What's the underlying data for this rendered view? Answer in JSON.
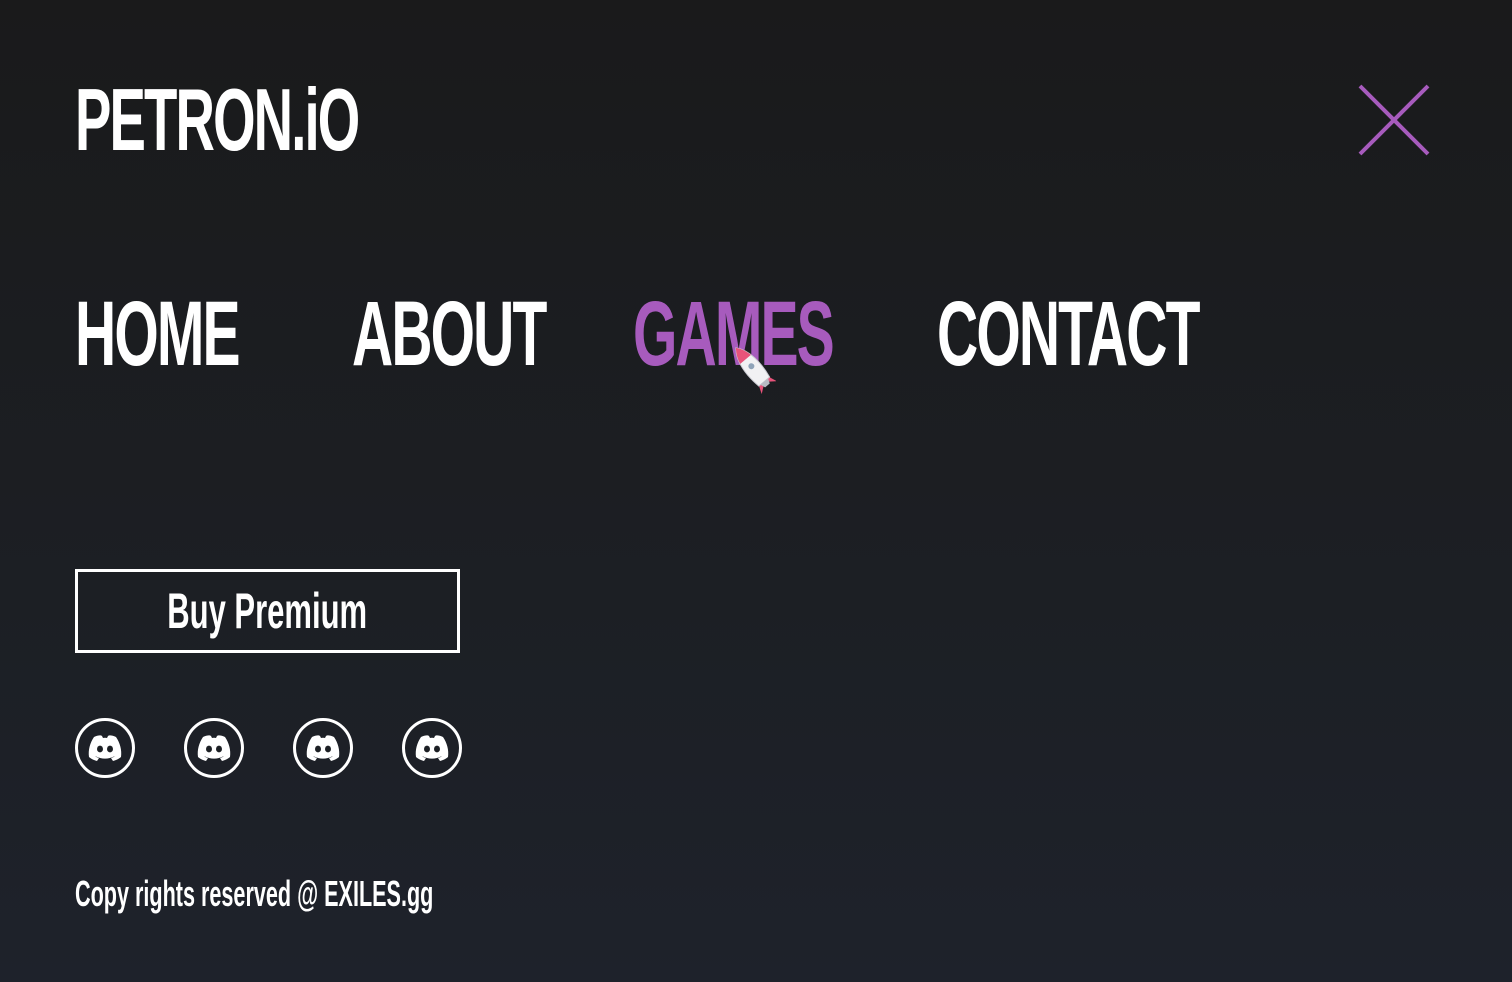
{
  "header": {
    "logo_text": "PETRON.iO",
    "close_icon": "close-icon",
    "accent_color": "#a75bbd"
  },
  "nav": {
    "items": [
      {
        "label": "HOME",
        "active": false
      },
      {
        "label": "ABOUT",
        "active": false
      },
      {
        "label": "GAMES",
        "active": true
      },
      {
        "label": "CONTACT",
        "active": false
      }
    ]
  },
  "cursor": {
    "icon": "rocket-cursor-icon"
  },
  "cta": {
    "label": "Buy Premium"
  },
  "socials": [
    {
      "icon": "discord-icon"
    },
    {
      "icon": "discord-icon"
    },
    {
      "icon": "discord-icon"
    },
    {
      "icon": "discord-icon"
    }
  ],
  "footer": {
    "copyright": "Copy rights reserved @ EXILES.gg"
  }
}
